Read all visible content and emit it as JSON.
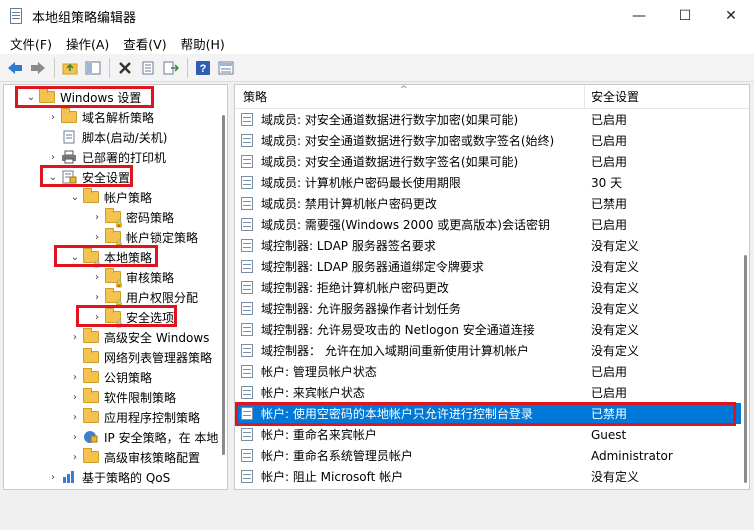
{
  "window": {
    "title": "本地组策略编辑器",
    "controls": [
      "—",
      "☐",
      "✕"
    ]
  },
  "menu": [
    "文件(F)",
    "操作(A)",
    "查看(V)",
    "帮助(H)"
  ],
  "toolbar": {
    "buttons": [
      "back-icon",
      "forward-icon",
      "up-folder-icon",
      "show-hide-tree-icon",
      "delete-icon",
      "properties-icon",
      "export-icon",
      "help-icon",
      "view-icon"
    ]
  },
  "tree": {
    "items": [
      {
        "label": "Windows 设置",
        "level": 0,
        "expanded": true
      },
      {
        "label": "域名解析策略",
        "level": 1,
        "expanded": false
      },
      {
        "label": "脚本(启动/关机)",
        "level": 1,
        "expanded": null
      },
      {
        "label": "已部署的打印机",
        "level": 1,
        "expanded": false
      },
      {
        "label": "安全设置",
        "level": 1,
        "expanded": true
      },
      {
        "label": "帐户策略",
        "level": 2,
        "expanded": true
      },
      {
        "label": "密码策略",
        "level": 3,
        "expanded": false
      },
      {
        "label": "帐户锁定策略",
        "level": 3,
        "expanded": false
      },
      {
        "label": "本地策略",
        "level": 2,
        "expanded": true
      },
      {
        "label": "审核策略",
        "level": 3,
        "expanded": false
      },
      {
        "label": "用户权限分配",
        "level": 3,
        "expanded": false
      },
      {
        "label": "安全选项",
        "level": 3,
        "expanded": false
      },
      {
        "label": "高级安全 Windows",
        "level": 2,
        "expanded": false
      },
      {
        "label": "网络列表管理器策略",
        "level": 2,
        "expanded": null
      },
      {
        "label": "公钥策略",
        "level": 2,
        "expanded": false
      },
      {
        "label": "软件限制策略",
        "level": 2,
        "expanded": false
      },
      {
        "label": "应用程序控制策略",
        "level": 2,
        "expanded": false
      },
      {
        "label": "IP 安全策略，在 本地",
        "level": 2,
        "expanded": false
      },
      {
        "label": "高级审核策略配置",
        "level": 2,
        "expanded": false
      },
      {
        "label": "基于策略的 QoS",
        "level": 1,
        "expanded": false
      }
    ]
  },
  "list": {
    "columns": [
      "策略",
      "安全设置"
    ],
    "rows": [
      {
        "policy": "域成员: 对安全通道数据进行数字加密(如果可能)",
        "setting": "已启用"
      },
      {
        "policy": "域成员: 对安全通道数据进行数字加密或数字签名(始终)",
        "setting": "已启用"
      },
      {
        "policy": "域成员: 对安全通道数据进行数字签名(如果可能)",
        "setting": "已启用"
      },
      {
        "policy": "域成员: 计算机帐户密码最长使用期限",
        "setting": "30 天"
      },
      {
        "policy": "域成员: 禁用计算机帐户密码更改",
        "setting": "已禁用"
      },
      {
        "policy": "域成员: 需要强(Windows 2000 或更高版本)会话密钥",
        "setting": "已启用"
      },
      {
        "policy": "域控制器: LDAP 服务器签名要求",
        "setting": "没有定义"
      },
      {
        "policy": "域控制器: LDAP 服务器通道绑定令牌要求",
        "setting": "没有定义"
      },
      {
        "policy": "域控制器: 拒绝计算机帐户密码更改",
        "setting": "没有定义"
      },
      {
        "policy": "域控制器: 允许服务器操作者计划任务",
        "setting": "没有定义"
      },
      {
        "policy": "域控制器: 允许易受攻击的 Netlogon 安全通道连接",
        "setting": "没有定义"
      },
      {
        "policy": "域控制器：  允许在加入域期间重新使用计算机帐户",
        "setting": "没有定义"
      },
      {
        "policy": "帐户: 管理员帐户状态",
        "setting": "已启用"
      },
      {
        "policy": "帐户: 来宾帐户状态",
        "setting": "已启用"
      },
      {
        "policy": "帐户: 使用空密码的本地帐户只允许进行控制台登录",
        "setting": "已禁用",
        "selected": true
      },
      {
        "policy": "帐户: 重命名来宾帐户",
        "setting": "Guest"
      },
      {
        "policy": "帐户: 重命名系统管理员帐户",
        "setting": "Administrator"
      },
      {
        "policy": "帐户: 阻止 Microsoft 帐户",
        "setting": "没有定义"
      }
    ]
  },
  "colors": {
    "selection": "#0078d7",
    "highlight_box": "#e0141e",
    "folder": "#f3c24f"
  }
}
